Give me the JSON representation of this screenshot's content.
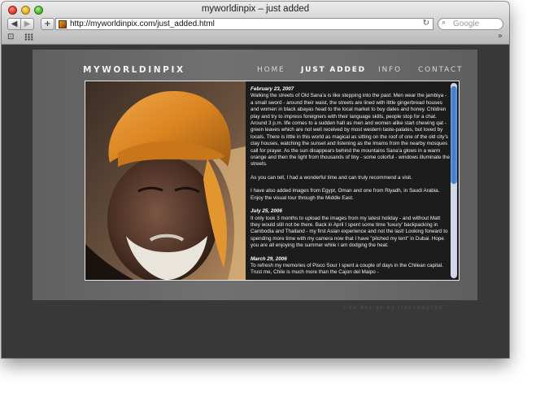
{
  "window": {
    "title": "myworldinpix – just added"
  },
  "toolbar": {
    "back": "◀",
    "forward": "▶",
    "add": "+",
    "url": "http://myworldinpix.com/just_added.html",
    "reload": "↻",
    "search_placeholder": "Google",
    "more": "»"
  },
  "site": {
    "logo": "MYWORLDINPIX",
    "nav": [
      "HOME",
      "JUST ADDED",
      "INFO",
      "CONTACT"
    ],
    "credit": "site design by ironcowprod"
  },
  "posts": [
    {
      "date": "February 23, 2007",
      "paragraphs": [
        "Walking the streets of Old Sana'a is like stepping into the past: Men wear the jambiya - a small sword - around their waist, the streets are lined with little gingerbread houses and women in black abayas head to the local market to buy dates and honey. Children play and try to impress foreigners with their language skills, people stop for a chat. Around 3 p.m. life comes to a sudden halt as men and women alike start chewing qat - green leaves which are not well received by most western taste-palates, but loved by locals. There is little in this world as magical as sitting on the roof of one of the old city's clay houses, watching the sunset and listening as the Imams from the nearby mosques call for prayer. As the sun disappears behind the mountains Sana'a glows in a warm orange and then the light from thousands of tiny - some colorful - windows illuminate the streets.",
        "As you can tell, I had a wonderful time and can truly recommend a visit.",
        "I have also added images from Egypt, Oman and one from Riyadh, in Saudi Arabia. Enjoy the visual tour through the Middle East."
      ]
    },
    {
      "date": "July 25, 2006",
      "paragraphs": [
        "It only took 3 months to upload the images from my latest holiday - and without Matt they would still not be there. Back in April I spent some time 'luxury' backpacking in Cambodia and Thailand - my first Asian experience and not the last! Looking forward to spending more time with my camera now that I have \"pitched my tent\" in Dubai. Hope you are all enjoying the summer while I am dodging the heat."
      ]
    },
    {
      "date": "March 29, 2006",
      "paragraphs": [
        "To refresh my memories of Pisco Sour I spent a couple of days in the Chilean capital. Trust me, Chile is much more than the Cajon del Maipo -"
      ]
    }
  ]
}
